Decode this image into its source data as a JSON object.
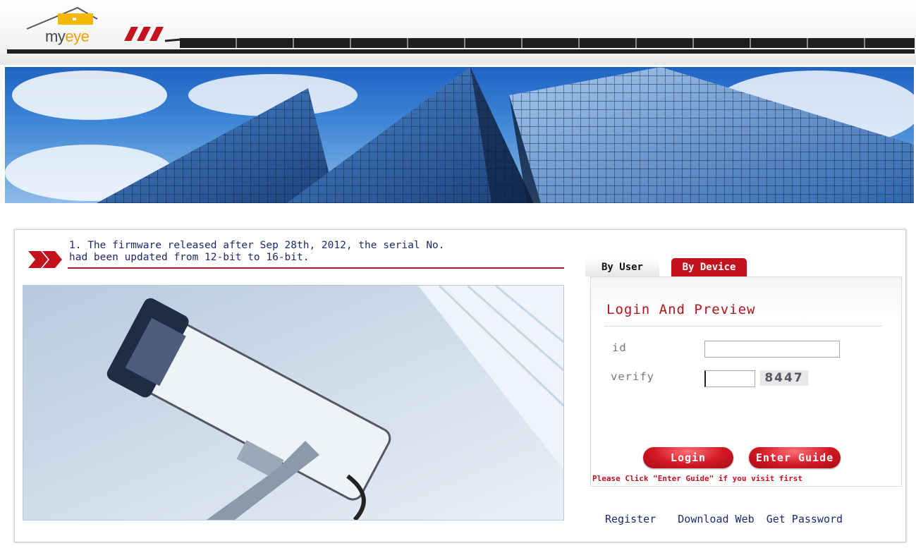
{
  "header": {
    "logo": {
      "text_main": "my",
      "text_accent": "eye"
    }
  },
  "notice": {
    "text": "1. The firmware released after Sep 28th, 2012, the serial No.\nhad been updated from 12-bit to 16-bit."
  },
  "login": {
    "tabs": [
      {
        "label": "By User",
        "active": false
      },
      {
        "label": "By Device",
        "active": true
      }
    ],
    "title": "Login And Preview",
    "id_label": "id",
    "id_value": "",
    "verify_label": "verify",
    "verify_value": "",
    "captcha": "8447",
    "login_button": "Login",
    "guide_button": "Enter Guide",
    "hint": "Please Click \"Enter Guide\" if you visit first",
    "links": {
      "register": "Register",
      "download": "Download Web",
      "password": "Get Password"
    }
  },
  "colors": {
    "accent_red": "#c4111e",
    "title_red": "#b5121b",
    "link_blue": "#1a2a6c",
    "nav_dark": "#1e1e1e"
  }
}
